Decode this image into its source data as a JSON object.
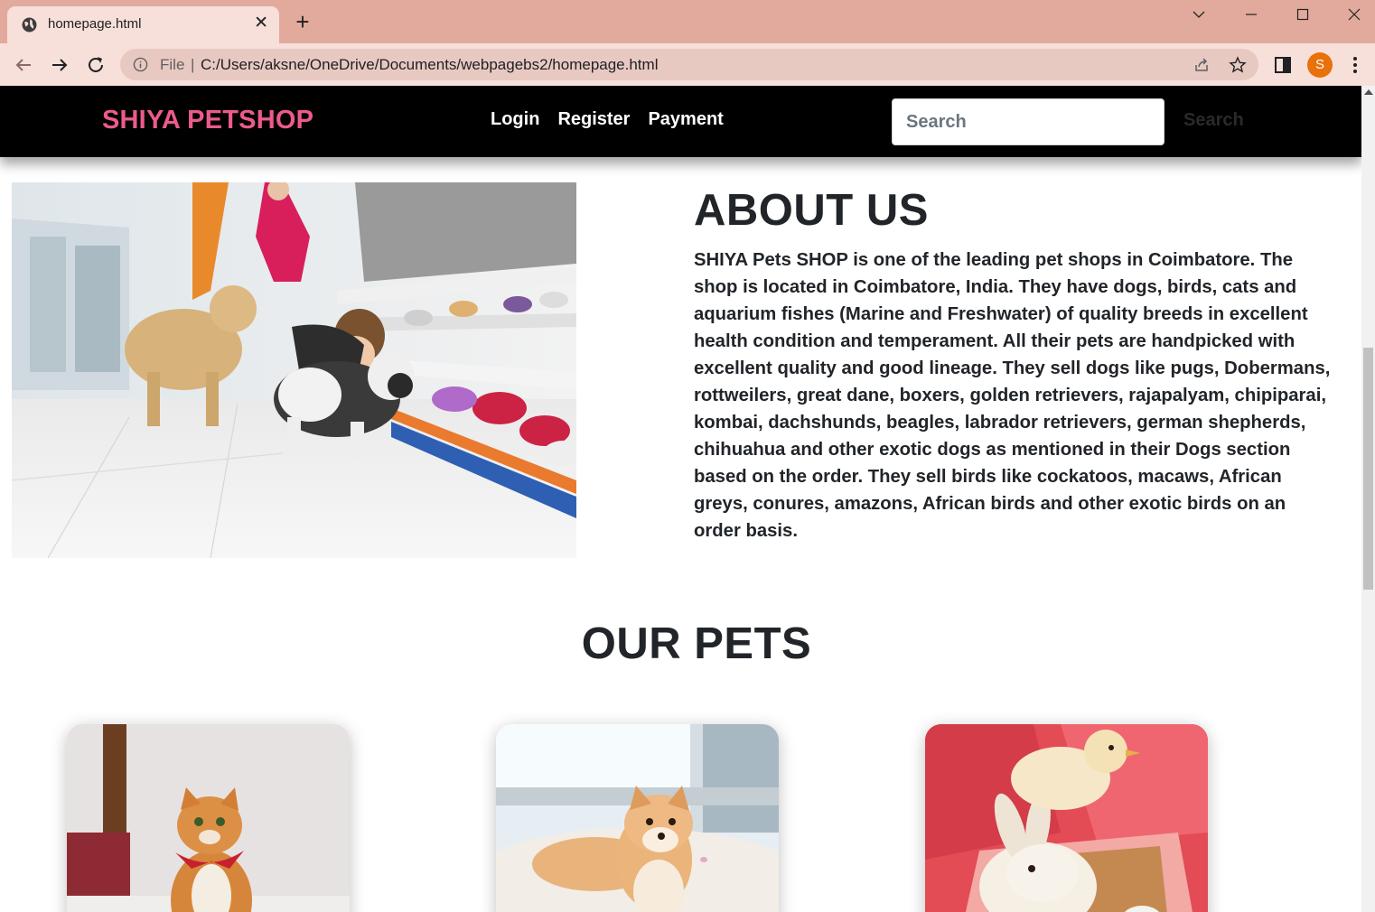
{
  "browser": {
    "tab_title": "homepage.html",
    "url_scheme": "File",
    "url": "C:/Users/aksne/OneDrive/Documents/webpagebs2/homepage.html",
    "profile_initial": "S",
    "icons": [
      "globe-icon",
      "close-icon",
      "plus-icon",
      "chevron-down-icon",
      "minimize-icon",
      "maximize-icon",
      "close-window-icon",
      "back-arrow-icon",
      "forward-arrow-icon",
      "reload-icon",
      "info-icon",
      "share-icon",
      "star-icon",
      "side-panel-icon",
      "kebab-menu-icon"
    ]
  },
  "site": {
    "brand": "SHIYA PETSHOP",
    "nav": [
      {
        "label": "Login"
      },
      {
        "label": "Register"
      },
      {
        "label": "Payment"
      }
    ],
    "search": {
      "placeholder": "Search",
      "button_label": "Search"
    },
    "colors": {
      "brand": "#ec5b8b",
      "navbar": "#000000",
      "text": "#212529"
    }
  },
  "about": {
    "title": "ABOUT US",
    "text": "SHIYA Pets SHOP is one of the leading pet shops in Coimbatore. The shop is located in Coimbatore, India. They have dogs, birds, cats and aquarium fishes (Marine and Freshwater) of quality breeds in excellent health condition and temperament. All their pets are handpicked with excellent quality and good lineage. They sell dogs like pugs, Dobermans, rottweilers, great dane, boxers, golden retrievers, rajapalyam, chipiparai, kombai, dachshunds, beagles, labrador retrievers, german shepherds, chihuahua and other exotic dogs as mentioned in their Dogs section based on the order. They sell birds like cockatoos, macaws, African greys, conures, amazons, African birds and other exotic birds on an order basis."
  },
  "pets": {
    "title": "OUR PETS"
  }
}
